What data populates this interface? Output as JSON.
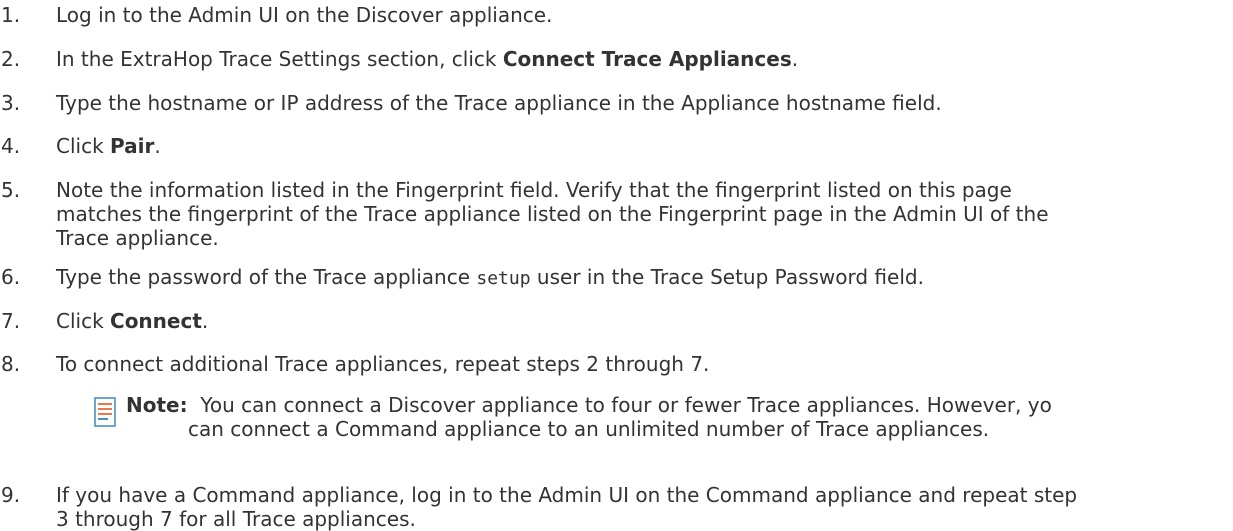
{
  "steps": [
    {
      "num": "1.",
      "parts": [
        "Log in to the Admin UI on the Discover appliance."
      ]
    },
    {
      "num": "2.",
      "pre": "In the ExtraHop Trace Settings section, click ",
      "strong": "Connect Trace Appliances",
      "post": "."
    },
    {
      "num": "3.",
      "text": "Type the hostname or IP address of the Trace appliance in the Appliance hostname field."
    },
    {
      "num": "4.",
      "pre": "Click ",
      "strong": "Pair",
      "post": "."
    },
    {
      "num": "5.",
      "lines": [
        "Note the information listed in the Fingerprint field. Verify that the fingerprint listed on this page",
        "matches the fingerprint of the Trace appliance listed on the Fingerprint page in the Admin UI of the",
        "Trace appliance."
      ]
    },
    {
      "num": "6.",
      "pre": "Type the password of the Trace appliance ",
      "code": "setup",
      "post": " user in the Trace Setup Password field."
    },
    {
      "num": "7.",
      "pre": "Click ",
      "strong": "Connect",
      "post": "."
    },
    {
      "num": "8.",
      "text": "To connect additional Trace appliances, repeat steps 2 through 7."
    },
    {
      "num": "9.",
      "lines": [
        "If you have a Command appliance, log in to the Admin UI on the Command appliance and repeat step",
        "3 through 7 for all Trace appliances."
      ]
    }
  ],
  "note": {
    "label": "Note:",
    "line1": "You can connect a Discover appliance to four or fewer Trace appliances. However, yo",
    "line2": "can connect a Command appliance to an unlimited number of Trace appliances.",
    "icon": "note-icon"
  },
  "colors": {
    "text": "#333333",
    "icon_blue": "#4a90c2",
    "icon_orange": "#e8794a"
  }
}
